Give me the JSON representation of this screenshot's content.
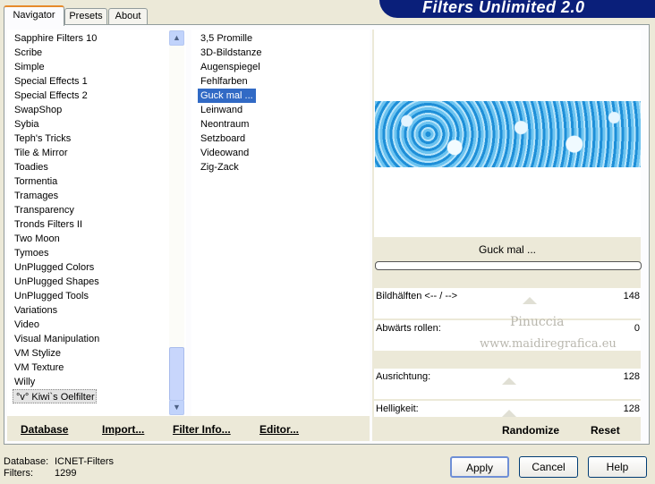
{
  "header": {
    "title": "Filters Unlimited 2.0"
  },
  "tabs": [
    {
      "label": "Navigator",
      "active": true
    },
    {
      "label": "Presets",
      "active": false
    },
    {
      "label": "About",
      "active": false
    }
  ],
  "categories": [
    "Sapphire Filters 10",
    "Scribe",
    "Simple",
    "Special Effects 1",
    "Special Effects 2",
    "SwapShop",
    "Sybia",
    "Teph's Tricks",
    "Tile & Mirror",
    "Toadies",
    "Tormentia",
    "Tramages",
    "Transparency",
    "Tronds Filters II",
    "Two Moon",
    "Tymoes",
    "UnPlugged Colors",
    "UnPlugged Shapes",
    "UnPlugged Tools",
    "Variations",
    "Video",
    "Visual Manipulation",
    "VM Stylize",
    "VM Texture",
    "Willy",
    "°v° Kiwi`s Oelfilter"
  ],
  "selected_category": "°v° Kiwi`s Oelfilter",
  "filters": [
    "3,5 Promille",
    "3D-Bildstanze",
    "Augenspiegel",
    "Fehlfarben",
    "Guck mal ...",
    "Leinwand",
    "Neontraum",
    "Setzboard",
    "Videowand",
    "Zig-Zack"
  ],
  "selected_filter": "Guck mal ...",
  "panel_links": {
    "database": "Database",
    "import": "Import...",
    "filter_info": "Filter Info...",
    "editor": "Editor..."
  },
  "preview": {
    "filter_name": "Guck mal ..."
  },
  "parameters": [
    {
      "label": "Bildhälften <-- / -->",
      "value": "148"
    },
    {
      "label": "Abwärts rollen:",
      "value": "0"
    },
    {
      "label": "Ausrichtung:",
      "value": "128"
    },
    {
      "label": "Helligkeit:",
      "value": "128"
    }
  ],
  "watermark": {
    "line1": "Pinuccia",
    "line2": "www.maidiregrafica.eu"
  },
  "right_links": {
    "randomize": "Randomize",
    "reset": "Reset"
  },
  "status": {
    "database_label": "Database:",
    "database_value": "ICNET-Filters",
    "filters_label": "Filters:",
    "filters_value": "1299"
  },
  "buttons": {
    "apply": "Apply",
    "cancel": "Cancel",
    "help": "Help"
  }
}
